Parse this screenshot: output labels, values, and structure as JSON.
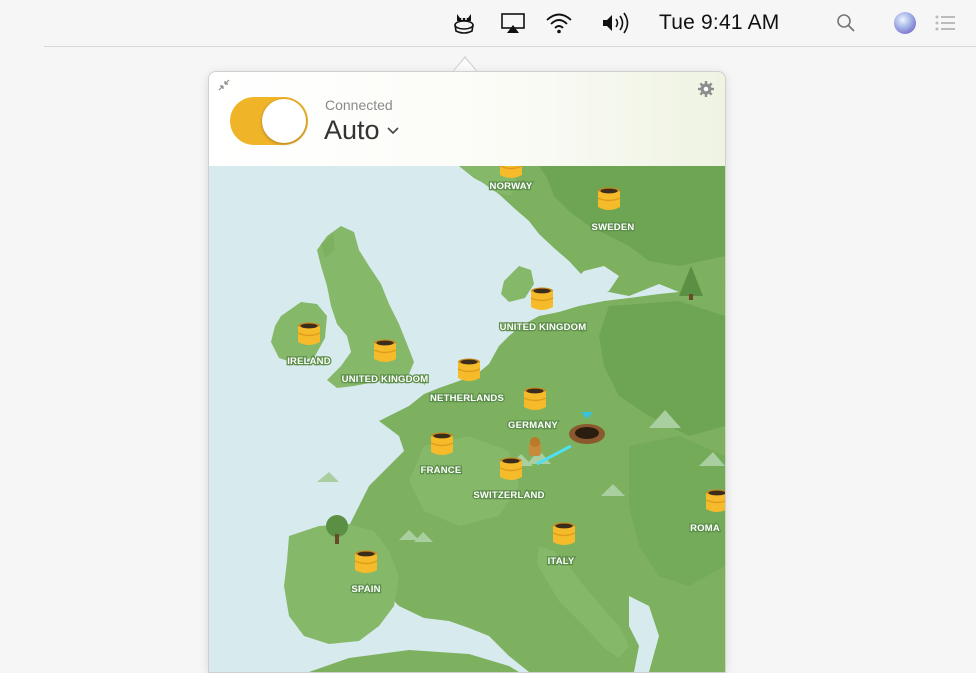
{
  "menubar": {
    "time": "Tue 9:41 AM",
    "icons": [
      "tunnelbear-icon",
      "airplay-icon",
      "wifi-icon",
      "volume-icon",
      "spotlight-icon",
      "siri-icon",
      "notification-center-icon"
    ]
  },
  "popover": {
    "status": "Connected",
    "location": "Auto",
    "toggle_on": true,
    "accent_color": "#f0b429"
  },
  "map": {
    "tunnels": [
      "NORWAY",
      "SWEDEN",
      "UNITED KINGDOM",
      "IRELAND",
      "UNITED KINGDOM",
      "NETHERLANDS",
      "GERMANY",
      "FRANCE",
      "SWITZERLAND",
      "ITALY",
      "SPAIN",
      "ROMA"
    ]
  }
}
